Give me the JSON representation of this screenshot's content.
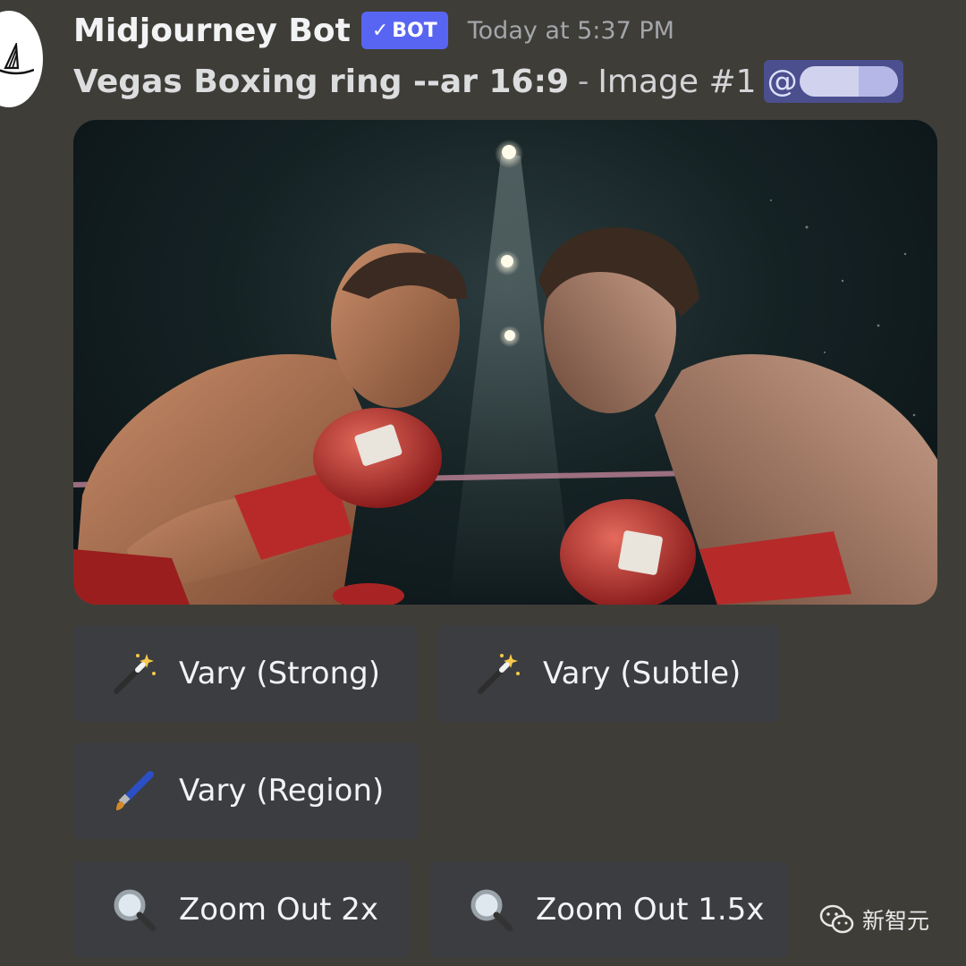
{
  "message": {
    "username": "Midjourney Bot",
    "badge": "BOT",
    "badge_check": "✓",
    "timestamp": "Today at 5:37 PM",
    "prompt": "Vegas Boxing ring --ar 16:9",
    "separator": "-",
    "image_label": "Image #1",
    "mention_prefix": "@"
  },
  "image": {
    "subject": "boxing-match-image"
  },
  "buttons": {
    "vary_strong": {
      "label": "Vary (Strong)",
      "icon": "magic-wand-icon"
    },
    "vary_subtle": {
      "label": "Vary (Subtle)",
      "icon": "magic-wand-icon"
    },
    "vary_region": {
      "label": "Vary (Region)",
      "icon": "paintbrush-icon"
    },
    "zoom_out_2x": {
      "label": "Zoom Out 2x",
      "icon": "magnifier-icon"
    },
    "zoom_out_15x": {
      "label": "Zoom Out 1.5x",
      "icon": "magnifier-icon"
    }
  },
  "watermark": {
    "text": "新智元",
    "icon": "wechat-icon"
  },
  "colors": {
    "background": "#3f3d38",
    "button": "#3c3d41",
    "bot_badge": "#5865f2",
    "mention": "#4b4f8e"
  }
}
